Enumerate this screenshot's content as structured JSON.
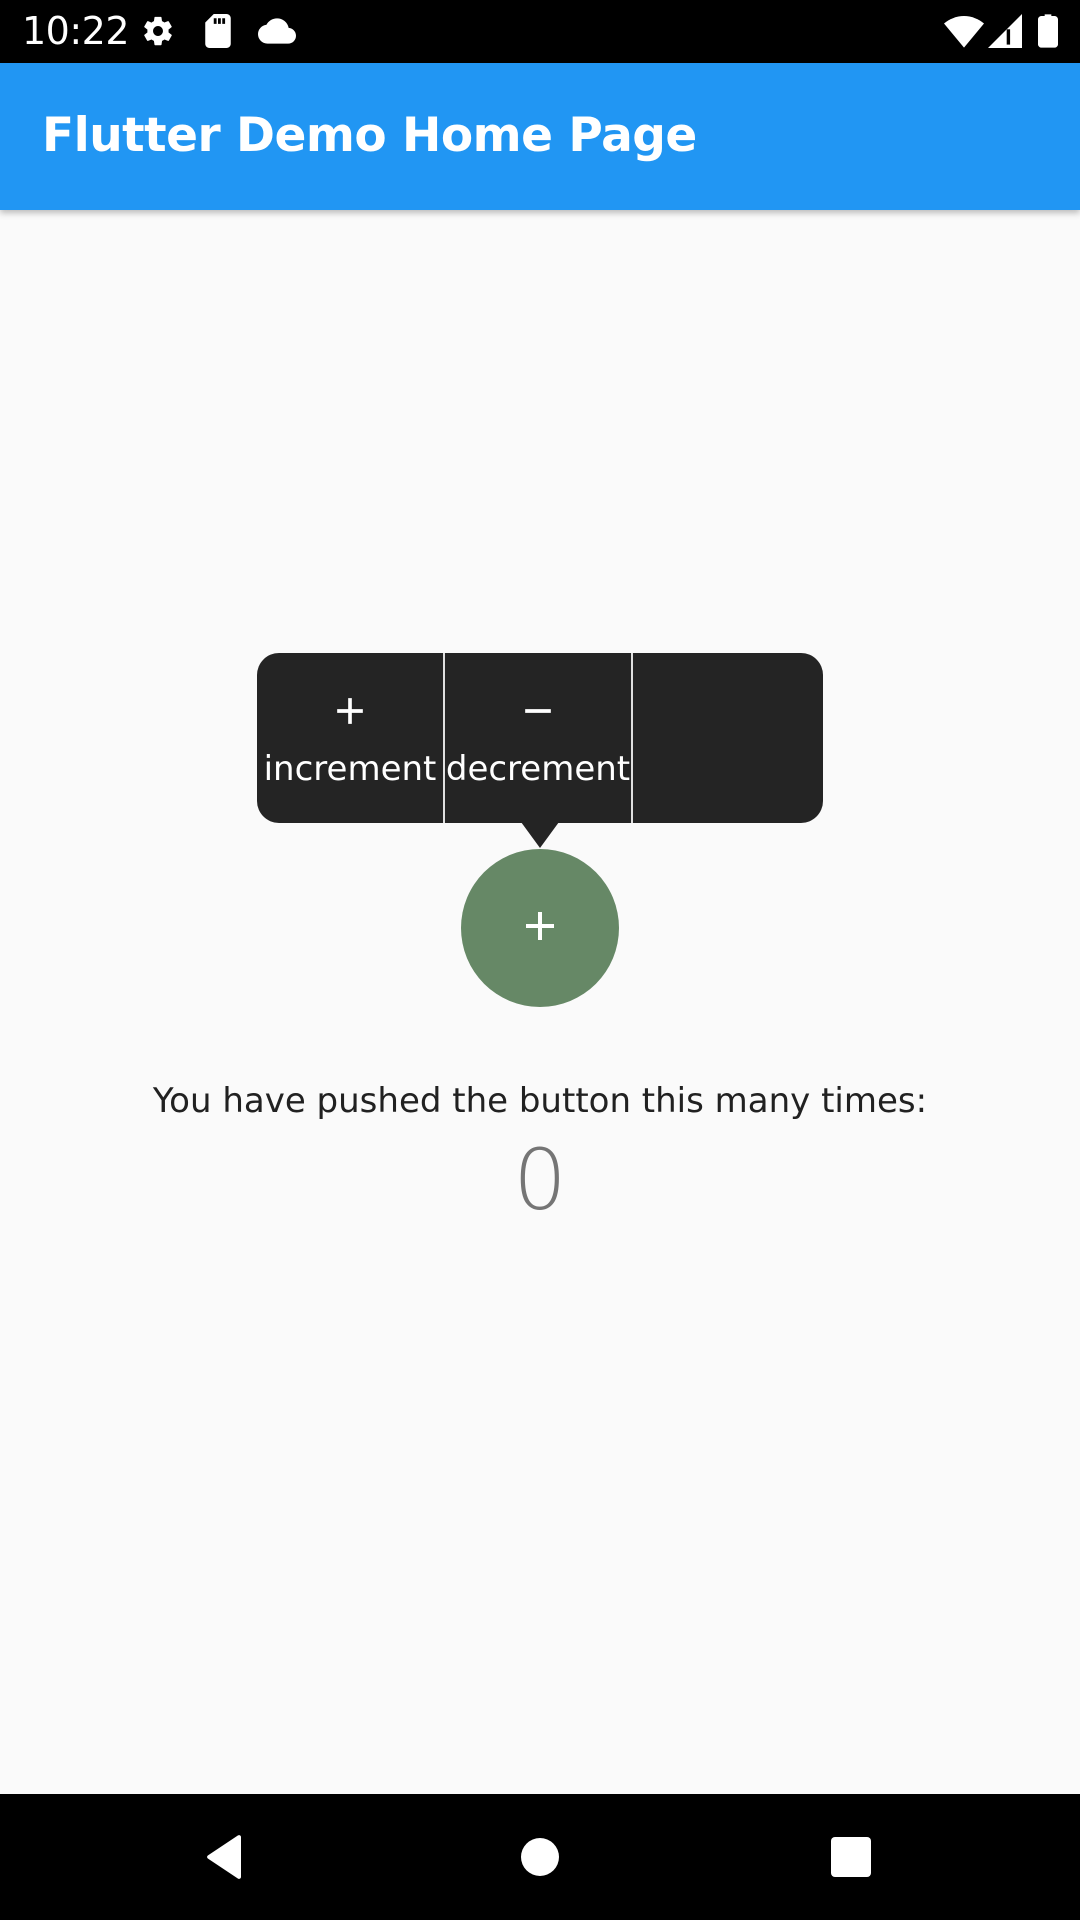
{
  "status_bar": {
    "time": "10:22",
    "icons": [
      "settings-icon",
      "sd-card-icon",
      "cloud-icon",
      "wifi-icon",
      "signal-icon",
      "battery-icon"
    ]
  },
  "app_bar": {
    "title": "Flutter Demo Home Page",
    "color": "#2196f3"
  },
  "popup_menu": {
    "items": [
      {
        "icon": "plus-icon",
        "label": "increment"
      },
      {
        "icon": "minus-icon",
        "label": "decrement"
      },
      {
        "icon": "",
        "label": ""
      }
    ],
    "background": "#242424"
  },
  "fab": {
    "icon": "plus-icon",
    "color": "#668866"
  },
  "content": {
    "counter_label": "You have pushed the button this many times:",
    "counter_value": "0"
  },
  "nav_bar": {
    "buttons": [
      "back-icon",
      "home-icon",
      "recents-icon"
    ]
  }
}
